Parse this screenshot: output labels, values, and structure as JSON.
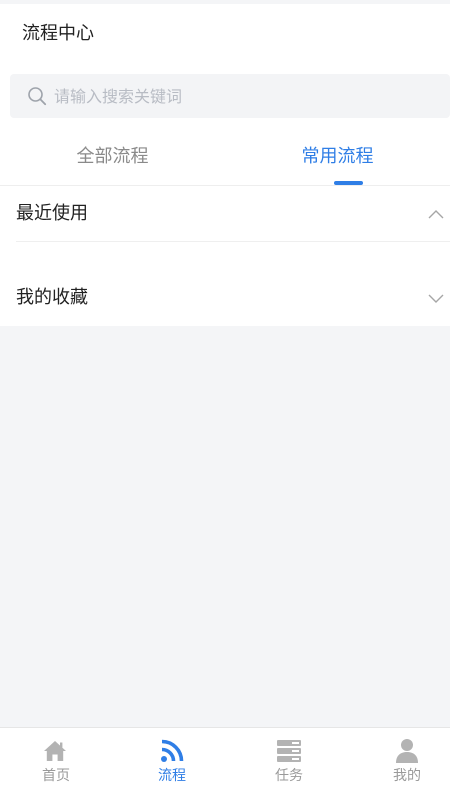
{
  "header": {
    "title": "流程中心"
  },
  "search": {
    "placeholder": "请输入搜索关键词",
    "value": ""
  },
  "tabs": [
    {
      "label": "全部流程",
      "active": false
    },
    {
      "label": "常用流程",
      "active": true
    }
  ],
  "sections": [
    {
      "title": "最近使用",
      "expanded": true
    },
    {
      "title": "我的收藏",
      "expanded": false
    }
  ],
  "tabbar": {
    "items": [
      {
        "label": "首页",
        "icon": "home-icon",
        "active": false
      },
      {
        "label": "流程",
        "icon": "rss-icon",
        "active": true
      },
      {
        "label": "任务",
        "icon": "task-list-icon",
        "active": false
      },
      {
        "label": "我的",
        "icon": "user-icon",
        "active": false
      }
    ]
  },
  "colors": {
    "accent": "#2f7ee6",
    "inactive": "#9a9a9a",
    "text": "#222222",
    "background": "#f4f5f7"
  }
}
